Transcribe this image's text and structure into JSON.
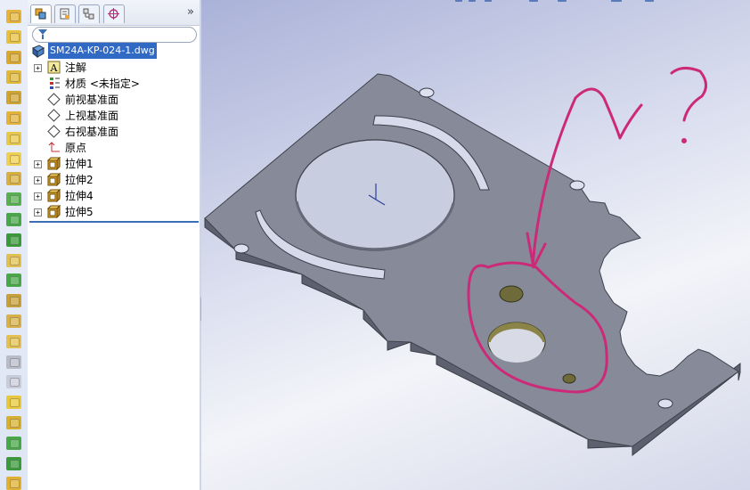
{
  "feature_tree": {
    "root": "SM24A-KP-024-1.dwg",
    "items": [
      {
        "label": "注解",
        "icon": "annotations-icon",
        "expandable": true
      },
      {
        "label": "材质 <未指定>",
        "icon": "material-icon",
        "expandable": false
      },
      {
        "label": "前视基准面",
        "icon": "plane-icon",
        "expandable": false
      },
      {
        "label": "上视基准面",
        "icon": "plane-icon",
        "expandable": false
      },
      {
        "label": "右视基准面",
        "icon": "plane-icon",
        "expandable": false
      },
      {
        "label": "原点",
        "icon": "origin-icon",
        "expandable": false
      },
      {
        "label": "拉伸1",
        "icon": "extrude-icon",
        "expandable": true
      },
      {
        "label": "拉伸2",
        "icon": "extrude-icon",
        "expandable": true
      },
      {
        "label": "拉伸4",
        "icon": "extrude-icon",
        "expandable": true
      },
      {
        "label": "拉伸5",
        "icon": "extrude-icon",
        "expandable": true
      }
    ]
  },
  "panel": {
    "tabs": [
      "feature-manager-tab",
      "property-manager-tab",
      "configuration-manager-tab",
      "dimxpert-tab"
    ],
    "collapse": "»"
  },
  "toolbar": {
    "icons": [
      "extruded-boss-icon",
      "revolved-boss-icon",
      "swept-boss-icon",
      "lofted-boss-icon",
      "extruded-cut-icon",
      "revolved-cut-icon",
      "fillet-icon",
      "chamfer-icon",
      "rib-icon",
      "shell-icon",
      "draft-icon",
      "dome-icon",
      "hole-wizard-icon",
      "linear-pattern-icon",
      "circular-pattern-icon",
      "mirror-icon",
      "reference-geometry-icon",
      "curves-icon",
      "instant3d-icon",
      "sheet-metal-icon",
      "weldment-icon",
      "mold-tools-icon",
      "move-face-icon",
      "split-line-icon"
    ]
  },
  "viewport": {
    "annotation_text": "?",
    "colors": {
      "part": "#8a8e9c",
      "part_edge": "#4a4d58",
      "markup": "#cc2a78"
    }
  }
}
